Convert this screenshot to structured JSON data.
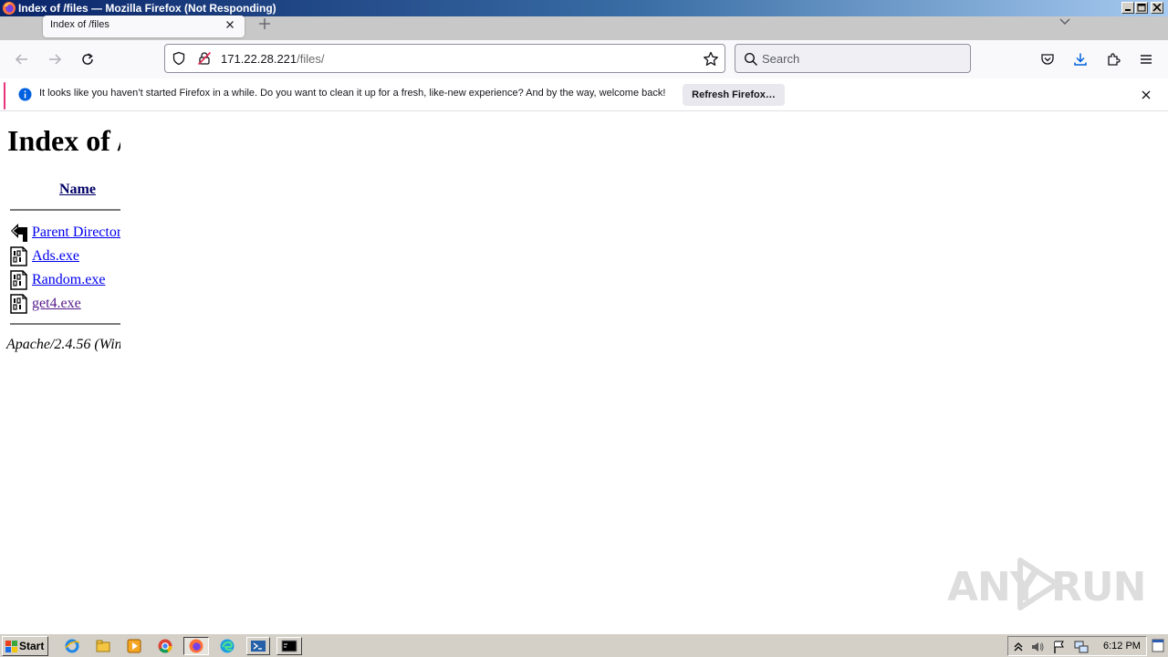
{
  "window": {
    "title": "Index of /files — Mozilla Firefox (Not Responding)"
  },
  "tabs": [
    {
      "label": "Index of /files"
    }
  ],
  "nav": {
    "url_host": "171.22.28.221",
    "url_path": "/files/",
    "search_placeholder": "Search"
  },
  "notification": {
    "message": "It looks like you haven’t started Firefox in a while. Do you want to clean it up for a fresh, like-new experience? And by the way, welcome back!",
    "button_label": "Refresh Firefox…"
  },
  "page": {
    "heading": "Index of /files",
    "column_header": "Name",
    "entries": [
      {
        "name": "Parent Directory",
        "icon": "back-arrow-icon"
      },
      {
        "name": "Ads.exe",
        "icon": "binary-file-icon"
      },
      {
        "name": "Random.exe",
        "icon": "binary-file-icon"
      },
      {
        "name": "get4.exe",
        "icon": "binary-file-icon",
        "visited": true
      }
    ],
    "footer": "Apache/2.4.56 (Win"
  },
  "watermark": {
    "text_left": "ANY",
    "text_right": "RUN"
  },
  "taskbar": {
    "start_label": "Start",
    "icons": [
      "ie-icon",
      "explorer-icon",
      "media-player-icon",
      "chrome-icon",
      "firefox-icon",
      "edge-icon",
      "powershell-icon",
      "cmd-icon"
    ],
    "clock": "6:12 PM"
  },
  "colors": {
    "accent_notification": "#e8327c",
    "link": "#0000ee",
    "visited_link": "#551a8b",
    "title_bar_start": "#0a246a"
  }
}
